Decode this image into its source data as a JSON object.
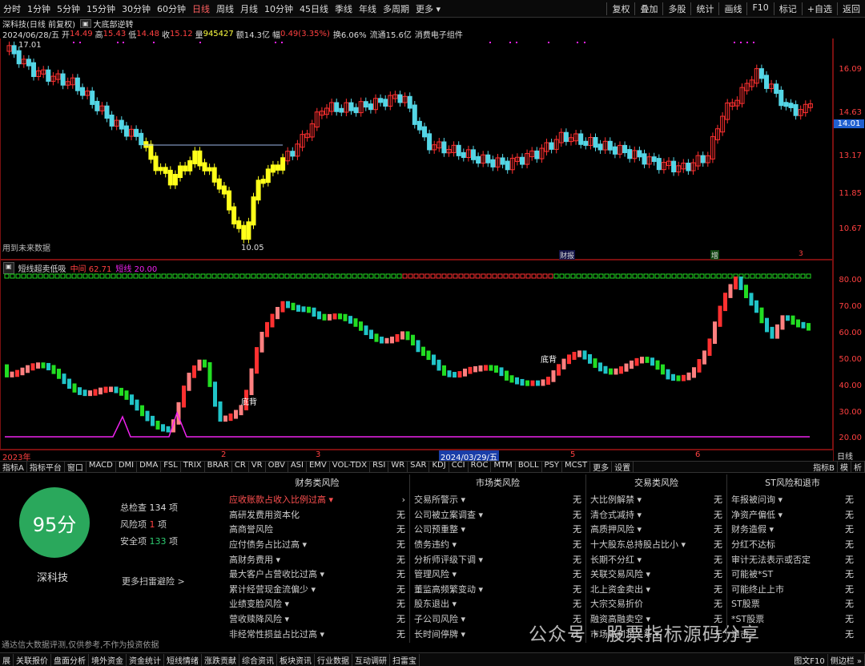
{
  "toolbar": {
    "periods": [
      "分时",
      "1分钟",
      "5分钟",
      "15分钟",
      "30分钟",
      "60分钟",
      "日线",
      "周线",
      "月线",
      "10分钟",
      "45日线",
      "季线",
      "年线",
      "多周期",
      "更多 ▾"
    ],
    "active": "日线",
    "right": [
      "复权",
      "叠加",
      "多股",
      "统计",
      "画线",
      "F10",
      "标记",
      "+自选",
      "返回"
    ]
  },
  "stock": {
    "title": "深科技(日线 前复权)",
    "indicator": "大底部逆转",
    "date": "2024/06/28/五",
    "open_label": "开",
    "open": "14.49",
    "high_label": "高",
    "high": "15.43",
    "low_label": "低",
    "low": "14.48",
    "close_label": "收",
    "close": "15.12",
    "vol_label": "量",
    "vol": "945427",
    "amt_label": "额",
    "amt": "14.3亿",
    "chg_label": "幅",
    "chg": "0.49(3.35%)",
    "turn": "换6.06%",
    "float": "流通15.6亿",
    "sector": "消费电子组件"
  },
  "candle": {
    "price_labels": [
      "16.09",
      "14.63",
      "13.17",
      "11.85",
      "10.67"
    ],
    "current_price": "14.01",
    "high_mark": "17.01",
    "low_mark": "10.05",
    "future_note": "用到未来数据",
    "tags": [
      "财报",
      "增",
      "3"
    ]
  },
  "osc": {
    "title": "短线超卖低吸",
    "mid_label": "中间",
    "mid": "62.71",
    "short_label": "短线",
    "short": "20.00",
    "levels": [
      "80.00",
      "70.00",
      "60.00",
      "50.00",
      "40.00",
      "30.00",
      "20.00"
    ],
    "div_labels": [
      "底背",
      "底背"
    ]
  },
  "dates": {
    "items": [
      "2023年",
      "2",
      "3",
      "2024/03/29/五",
      "5",
      "6"
    ],
    "right": "日线"
  },
  "tabs": {
    "items": [
      "指标A",
      "指标平台",
      "窗口",
      "MACD",
      "DMI",
      "DMA",
      "FSL",
      "TRIX",
      "BRAR",
      "CR",
      "VR",
      "OBV",
      "ASI",
      "EMV",
      "VOL-TDX",
      "RSI",
      "WR",
      "SAR",
      "KDJ",
      "CCI",
      "ROC",
      "MTM",
      "BOLL",
      "PSY",
      "MCST",
      "更多",
      "设置"
    ],
    "right": [
      "指标B",
      "模",
      "析"
    ]
  },
  "scan": {
    "score": "95分",
    "name": "深科技",
    "total_label": "总检查",
    "total": "134",
    "risk_label": "风险项",
    "risk": "1",
    "safe_label": "安全项",
    "safe": "133",
    "unit": "项",
    "more": "更多扫雷避险 >",
    "columns": [
      {
        "title": "财务类风险",
        "rows": [
          [
            "应收账款占收入比例过高 ▾",
            "›"
          ],
          [
            "高研发费用资本化",
            "无"
          ],
          [
            "高商誉风险",
            "无"
          ],
          [
            "应付债务占比过高 ▾",
            "无"
          ],
          [
            "高财务费用 ▾",
            "无"
          ],
          [
            "最大客户占营收比过高 ▾",
            "无"
          ],
          [
            "累计经营现金流偏少 ▾",
            "无"
          ],
          [
            "业绩变脸风险 ▾",
            "无"
          ],
          [
            "营收赎降风险 ▾",
            "无"
          ],
          [
            "非经常性损益占比过高 ▾",
            "无"
          ]
        ]
      },
      {
        "title": "市场类风险",
        "rows": [
          [
            "交易所警示 ▾",
            "无"
          ],
          [
            "公司被立案调查 ▾",
            "无"
          ],
          [
            "公司预重整 ▾",
            "无"
          ],
          [
            "债务违约 ▾",
            "无"
          ],
          [
            "分析师评级下调 ▾",
            "无"
          ],
          [
            "管理风险 ▾",
            "无"
          ],
          [
            "董监高频繁变动 ▾",
            "无"
          ],
          [
            "股东退出 ▾",
            "无"
          ],
          [
            "子公司风险 ▾",
            "无"
          ],
          [
            "长时间停牌 ▾",
            "无"
          ]
        ]
      },
      {
        "title": "交易类风险",
        "rows": [
          [
            "大比例解禁 ▾",
            "无"
          ],
          [
            "清仓式减持 ▾",
            "无"
          ],
          [
            "高质押风险 ▾",
            "无"
          ],
          [
            "十大股东总持股占比小 ▾",
            "无"
          ],
          [
            "长期不分红 ▾",
            "无"
          ],
          [
            "关联交易风险 ▾",
            "无"
          ],
          [
            "北上资金卖出 ▾",
            "无"
          ],
          [
            "大宗交易折价",
            "无"
          ],
          [
            "融资高融卖空 ▾",
            "无"
          ],
          [
            "市场高利润关系 ▾",
            "无"
          ]
        ]
      },
      {
        "title": "ST风险和退市",
        "rows": [
          [
            "年报被问询 ▾",
            "无"
          ],
          [
            "净资产偏低 ▾",
            "无"
          ],
          [
            "财务造假 ▾",
            "无"
          ],
          [
            "分红不达标",
            "无"
          ],
          [
            "审计无法表示或否定",
            "无"
          ],
          [
            "可能被*ST",
            "无"
          ],
          [
            "可能终止上市",
            "无"
          ],
          [
            "ST股票",
            "无"
          ],
          [
            "*ST股票",
            "无"
          ],
          [
            "退市",
            "无"
          ]
        ]
      }
    ],
    "disclaimer": "通达信大数据评测,仅供参考,不作为投资依据",
    "watermark": "公众号 · 股票指标源码分享"
  },
  "bottom": {
    "items": [
      "展",
      "关联报价",
      "盘面分析",
      "境外资金",
      "资金统计",
      "短线情绪",
      "涨跌贡献",
      "综合资讯",
      "板块资讯",
      "行业数据",
      "互动调研",
      "扫雷宝"
    ],
    "right": [
      "图文F10",
      "侧边栏 »"
    ]
  },
  "colors": {
    "up": "#ff3030",
    "down": "#54d6e6",
    "yellow": "#ffff1a",
    "green": "#22dd22",
    "pink": "#ff8080",
    "teal": "#20c4c8",
    "magenta": "#ee22ee"
  }
}
